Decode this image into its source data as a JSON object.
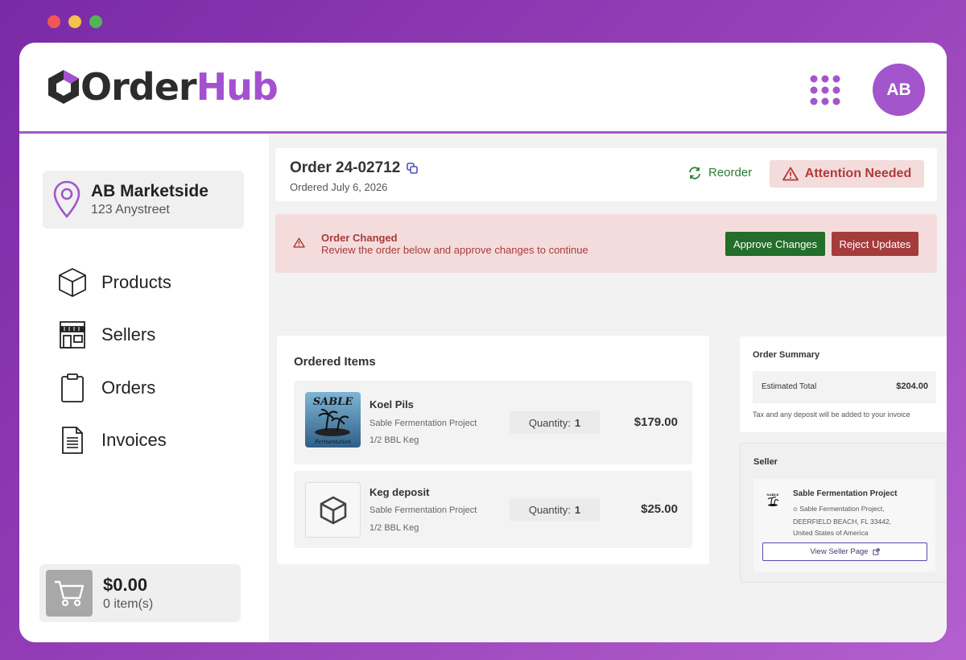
{
  "app": {
    "logo_part1": "Order",
    "logo_part2": "Hub",
    "avatar_initials": "AB",
    "brand_color": "#a451cf"
  },
  "window_controls": [
    "red-dot",
    "yellow-dot",
    "green-dot"
  ],
  "sidebar": {
    "store": {
      "name": "AB Marketside",
      "address": "123 Anystreet"
    },
    "items": [
      {
        "label": "Products",
        "icon": "box-icon"
      },
      {
        "label": "Sellers",
        "icon": "storefront-icon"
      },
      {
        "label": "Orders",
        "icon": "clipboard-icon"
      },
      {
        "label": "Invoices",
        "icon": "document-icon"
      }
    ],
    "cart": {
      "total": "$0.00",
      "count": "0 item(s)"
    }
  },
  "order": {
    "title": "Order 24-02712",
    "date": "Ordered July 6, 2026",
    "reorder_label": "Reorder",
    "status_label": "Attention Needed"
  },
  "alert": {
    "title": "Order Changed",
    "message": "Review the order below and approve changes to continue",
    "approve_label": "Approve Changes",
    "reject_label": "Reject Updates"
  },
  "items_panel": {
    "title": "Ordered Items",
    "quantity_label": "Quantity:",
    "items": [
      {
        "name": "Koel Pils",
        "seller": "Sable Fermentation Project",
        "size": "1/2 BBL Keg",
        "quantity": "1",
        "price": "$179.00",
        "thumb": "sable-logo-image"
      },
      {
        "name": "Keg deposit",
        "seller": "Sable Fermentation Project",
        "size": "1/2 BBL Keg",
        "quantity": "1",
        "price": "$25.00",
        "thumb": "box-icon"
      }
    ]
  },
  "summary": {
    "title": "Order Summary",
    "total_label": "Estimated Total",
    "total_value": "$204.00",
    "note": "Tax and any deposit will be added to your invoice"
  },
  "seller": {
    "title": "Seller",
    "name": "Sable Fermentation Project",
    "address_line1": "Sable Fermentation Project,",
    "address_line2": "DEERFIELD BEACH, FL 33442,",
    "address_line3": "United States of America",
    "button_label": "View Seller Page"
  },
  "colors": {
    "success": "#226e2a",
    "danger": "#a53c3c",
    "alert_bg": "#f4dcdc",
    "reorder": "#2a7d35"
  }
}
